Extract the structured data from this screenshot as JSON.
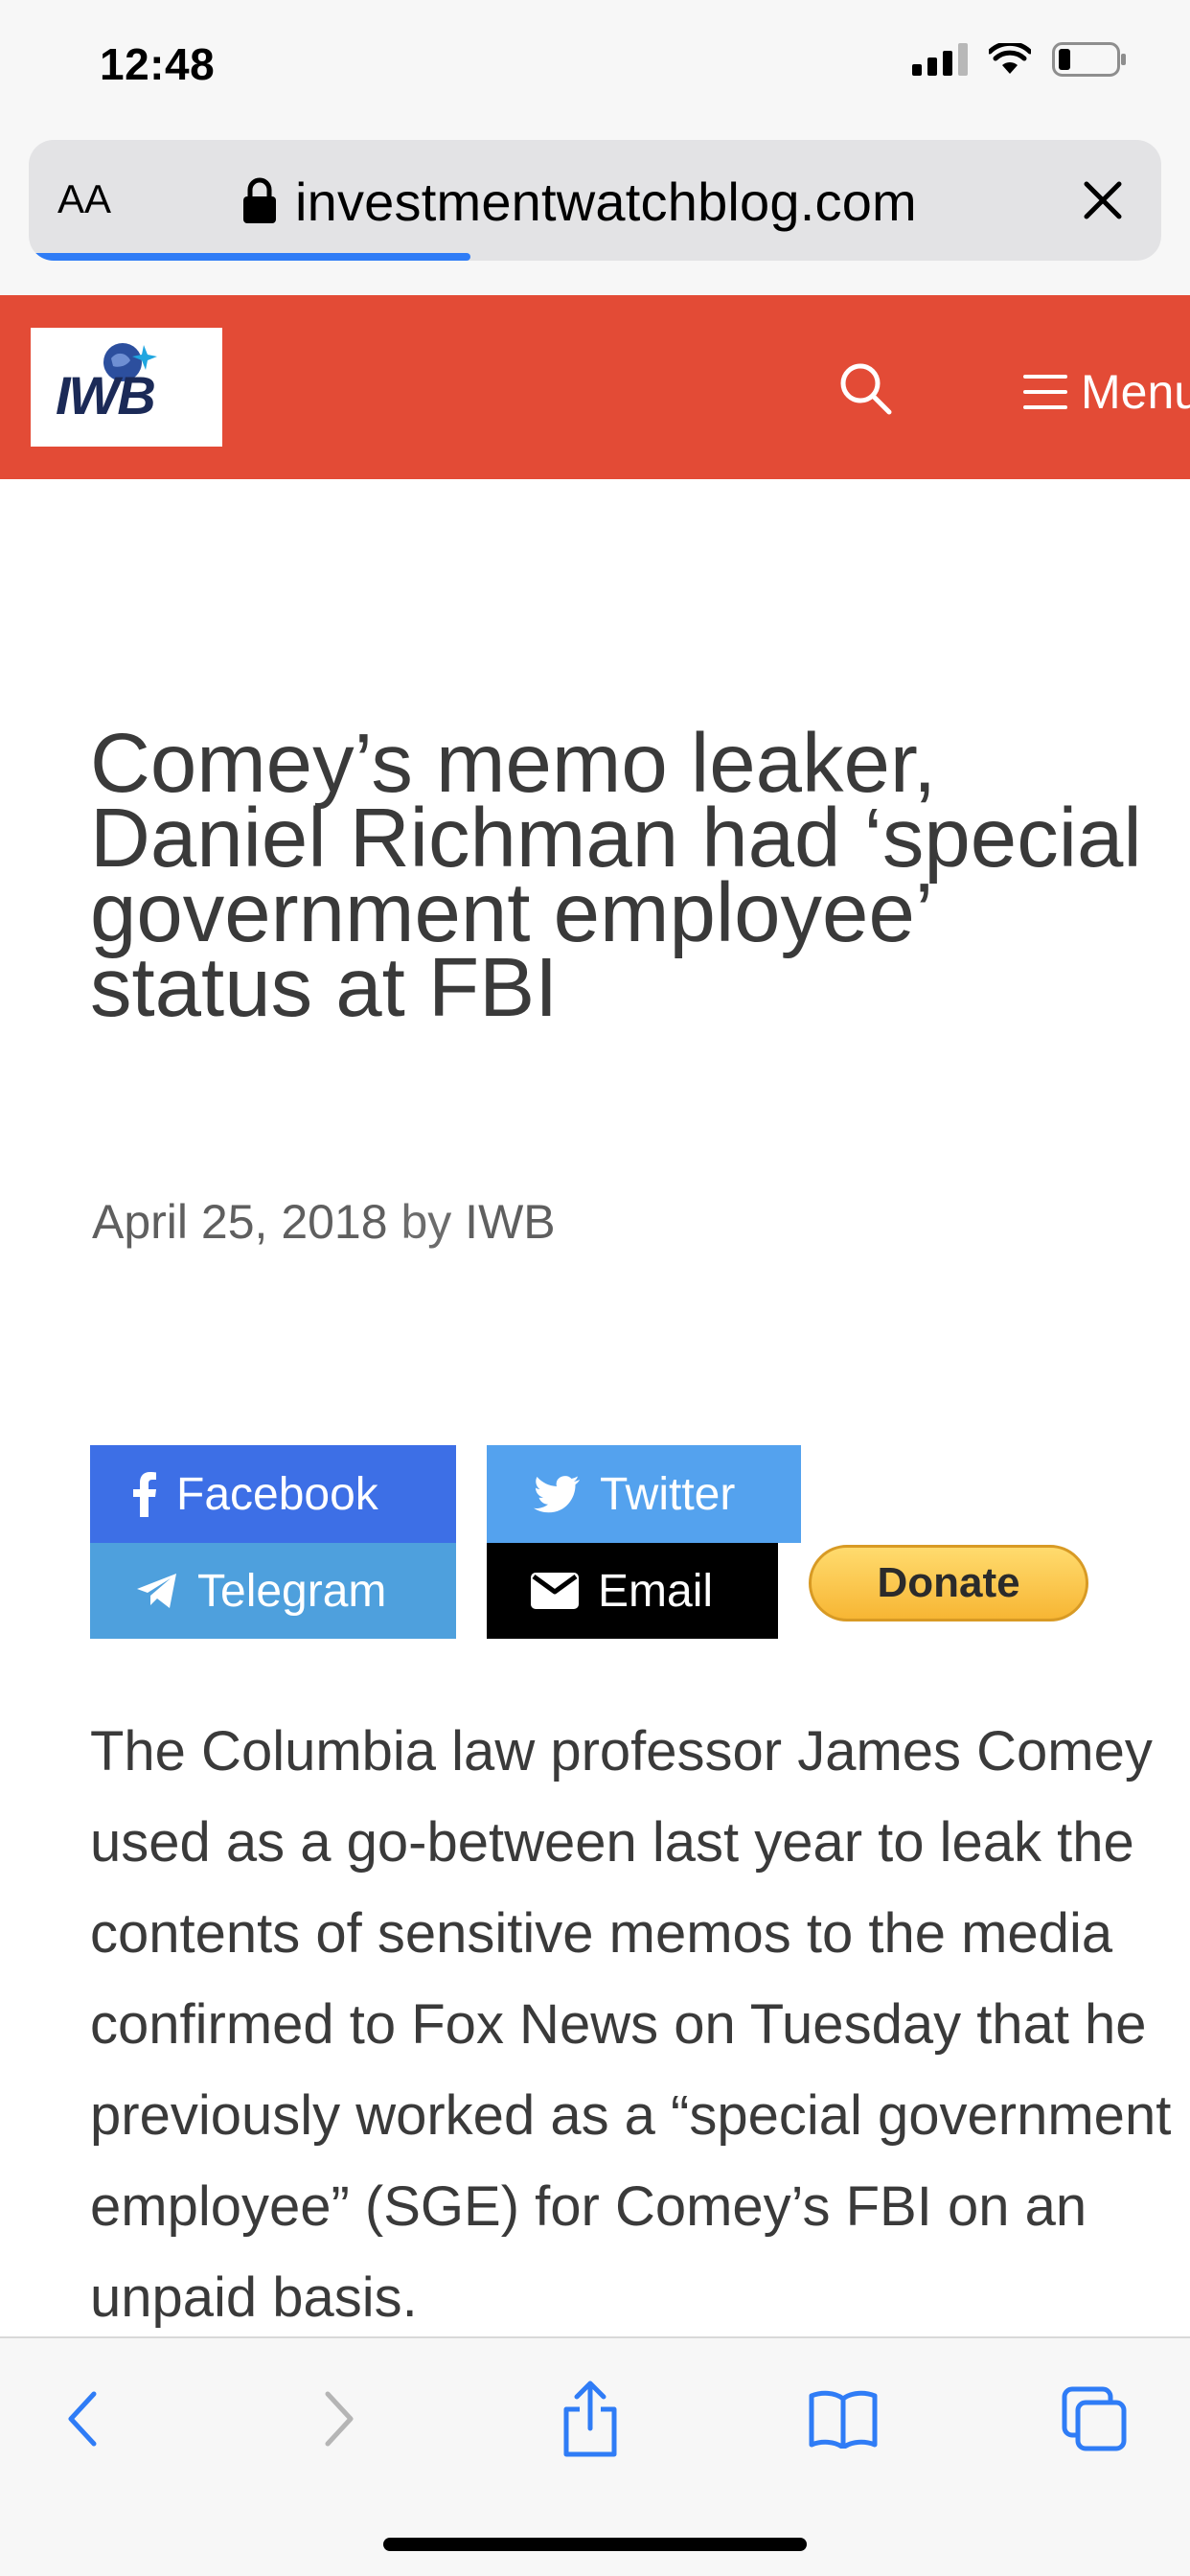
{
  "status_bar": {
    "time": "12:48"
  },
  "browser": {
    "text_size_label": "AA",
    "url": "investmentwatchblog.com",
    "load_progress": 0.39
  },
  "site": {
    "logo_text": "IWB",
    "menu_label": "Menu",
    "header_color": "#e34b36"
  },
  "article": {
    "title": "Comey’s memo leaker, Daniel Richman had ‘special government employee’ status at FBI",
    "date": "April 25, 2018",
    "by_label": "by",
    "author": "IWB",
    "body": "The Columbia law professor James Comey used as a go-between last year to leak the contents of sensitive memos to the media confirmed to Fox News on Tuesday that he previously worked as a “special government employee” (SGE) for Comey’s FBI on an unpaid basis."
  },
  "share": {
    "facebook": "Facebook",
    "twitter": "Twitter",
    "telegram": "Telegram",
    "email": "Email",
    "donate": "Donate"
  },
  "icons": {
    "back": "chevron-left-icon",
    "forward": "chevron-right-icon",
    "share": "share-icon",
    "bookmarks": "book-icon",
    "tabs": "tabs-icon"
  }
}
